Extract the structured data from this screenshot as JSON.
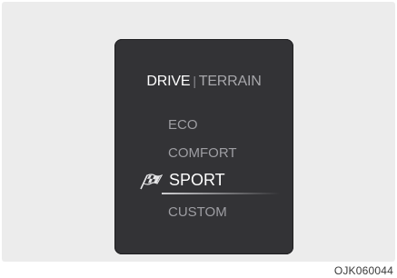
{
  "tabs": {
    "active": "DRIVE",
    "separator": "|",
    "inactive": "TERRAIN"
  },
  "modes": [
    {
      "label": "ECO",
      "selected": false
    },
    {
      "label": "COMFORT",
      "selected": false
    },
    {
      "label": "SPORT",
      "selected": true,
      "icon": "checkered-flag-icon"
    },
    {
      "label": "CUSTOM",
      "selected": false
    }
  ],
  "caption": "OJK060044",
  "colors": {
    "screen": "#333336",
    "selected_text": "#ffffff",
    "unselected_text": "#9e9ea3"
  }
}
